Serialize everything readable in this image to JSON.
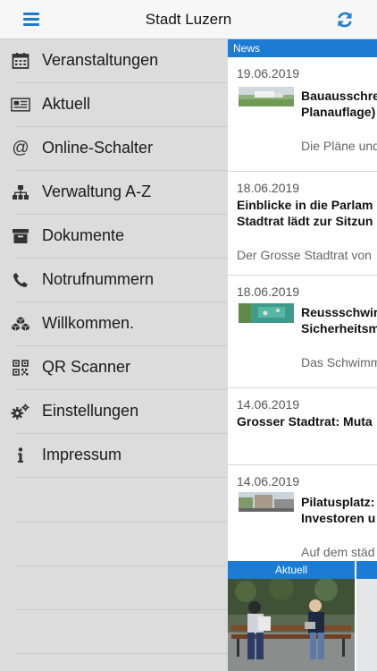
{
  "header": {
    "title": "Stadt Luzern"
  },
  "sidebar": {
    "items": [
      {
        "label": "Veranstaltungen",
        "icon": "calendar-icon"
      },
      {
        "label": "Aktuell",
        "icon": "newspaper-icon"
      },
      {
        "label": "Online-Schalter",
        "icon": "at-icon"
      },
      {
        "label": "Verwaltung A-Z",
        "icon": "sitemap-icon"
      },
      {
        "label": "Dokumente",
        "icon": "archive-box-icon"
      },
      {
        "label": "Notrufnummern",
        "icon": "phone-icon"
      },
      {
        "label": "Willkommen.",
        "icon": "cubes-icon"
      },
      {
        "label": "QR Scanner",
        "icon": "qrcode-icon"
      },
      {
        "label": "Einstellungen",
        "icon": "gears-icon"
      },
      {
        "label": "Impressum",
        "icon": "info-icon"
      }
    ]
  },
  "news": {
    "tab_label": "News",
    "items": [
      {
        "date": "19.06.2019",
        "title_lines": [
          "Bauausschre",
          "Planauflage)"
        ],
        "teaser": "Die Pläne und"
      },
      {
        "date": "18.06.2019",
        "title_lines": [
          "Einblicke in die Parlam",
          "Stadtrat lädt zur Sitzun"
        ],
        "teaser": "Der Grosse Stadtrat von"
      },
      {
        "date": "18.06.2019",
        "title_lines": [
          "Reussschwir",
          "Sicherheitsm"
        ],
        "teaser": "Das Schwimm"
      },
      {
        "date": "14.06.2019",
        "title_lines": [
          "Grosser Stadtrat: Muta"
        ],
        "teaser": ""
      },
      {
        "date": "14.06.2019",
        "title_lines": [
          "Pilatusplatz:",
          "Investoren u"
        ],
        "teaser": "Auf dem städ"
      }
    ]
  },
  "bottom": {
    "tab_label": "Aktuell"
  },
  "colors": {
    "accent": "#1c7bd2",
    "sidebar_bg": "#dcdcdc"
  }
}
